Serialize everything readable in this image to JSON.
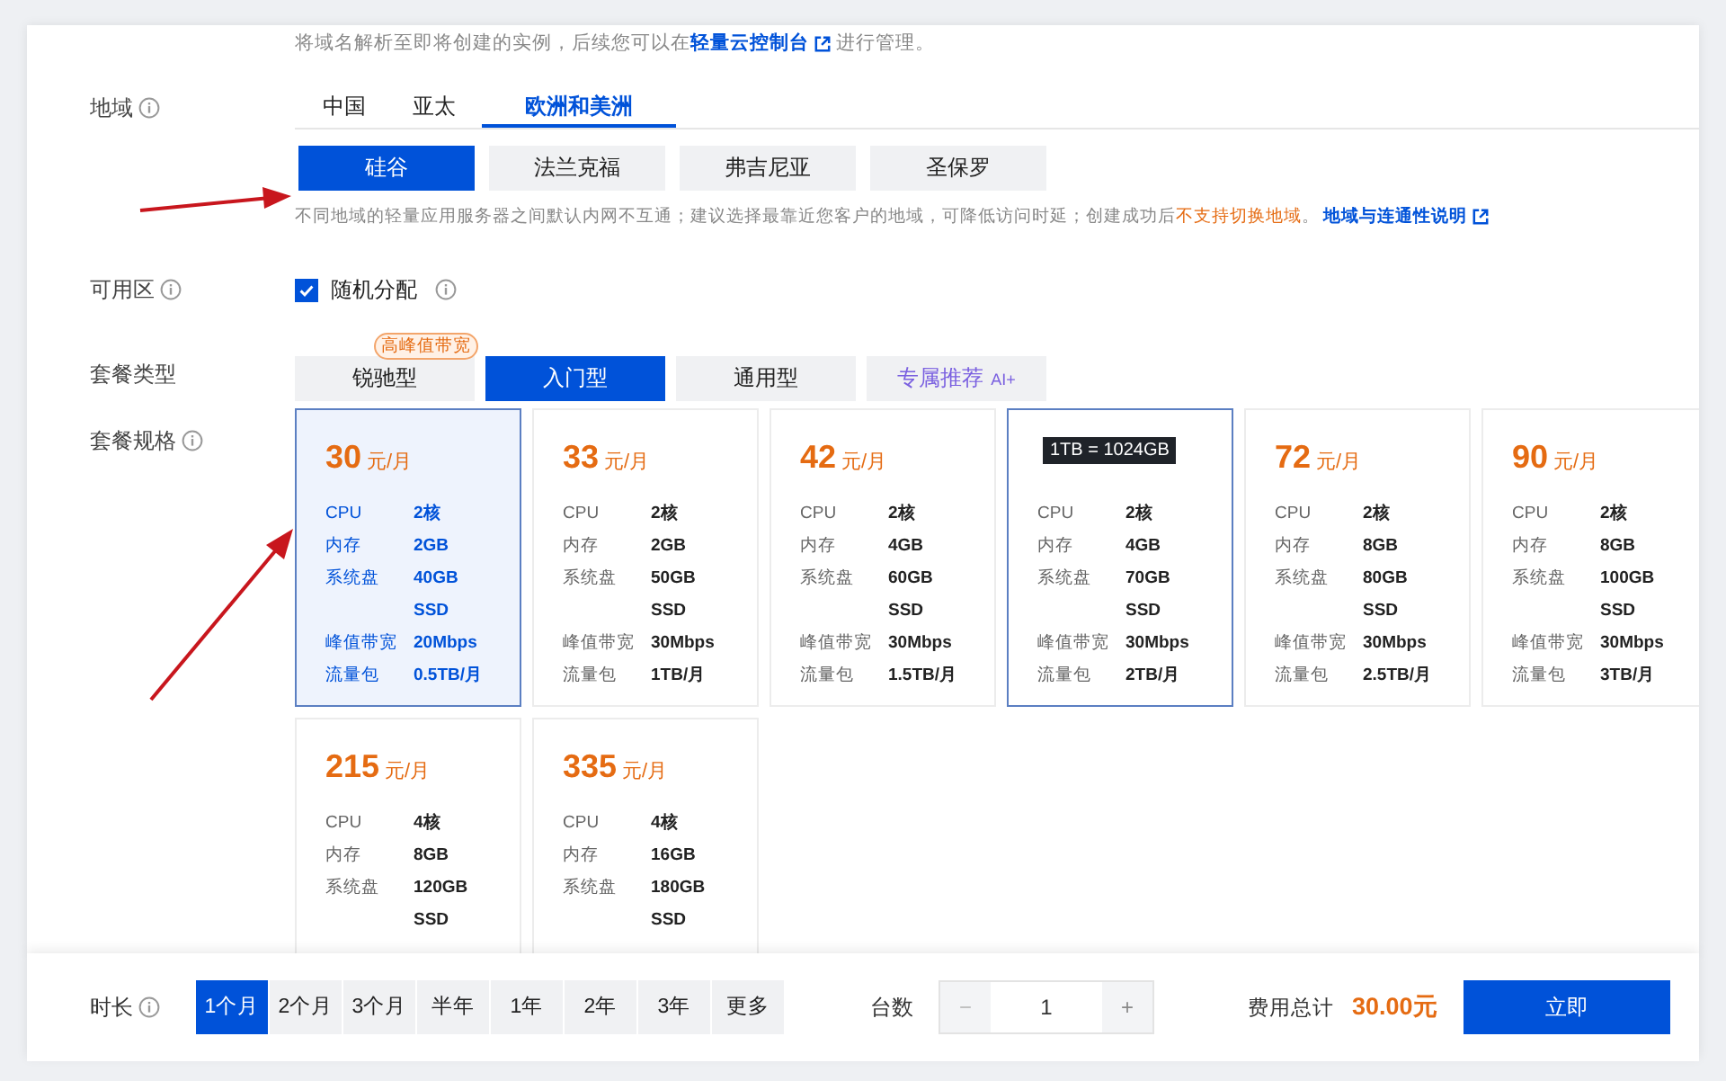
{
  "intro": {
    "before": "将域名解析至即将创建的实例，后续您可以在",
    "link": "轻量云控制台",
    "after": "进行管理。"
  },
  "region": {
    "label": "地域",
    "tabs": [
      {
        "label": "中国",
        "selected": false
      },
      {
        "label": "亚太",
        "selected": false
      },
      {
        "label": "欧洲和美洲",
        "selected": true
      }
    ],
    "cities": [
      {
        "label": "硅谷",
        "selected": true
      },
      {
        "label": "法兰克福",
        "selected": false
      },
      {
        "label": "弗吉尼亚",
        "selected": false
      },
      {
        "label": "圣保罗",
        "selected": false
      }
    ],
    "hint": {
      "text": "不同地域的轻量应用服务器之间默认内网不互通；建议选择最靠近您客户的地域，可降低访问时延；创建成功后",
      "warning": "不支持切换地域",
      "after": "。",
      "link": "地域与连通性说明"
    }
  },
  "zone": {
    "label": "可用区",
    "option": {
      "label": "随机分配",
      "checked": true
    }
  },
  "plan_type": {
    "label": "套餐类型",
    "options": [
      {
        "label": "锐驰型",
        "selected": false,
        "badge": "高峰值带宽"
      },
      {
        "label": "入门型",
        "selected": true
      },
      {
        "label": "通用型",
        "selected": false
      },
      {
        "label": "专属推荐",
        "selected": false,
        "tag": "AI+"
      }
    ]
  },
  "plan_spec": {
    "label": "套餐规格",
    "tooltip": "1TB = 1024GB",
    "cards": [
      {
        "price": "30",
        "unit": "元/月",
        "selected": true,
        "hovered": false,
        "specs": [
          {
            "name": "CPU",
            "value": "2核"
          },
          {
            "name": "内存",
            "value": "2GB"
          },
          {
            "name": "系统盘",
            "value": "40GB SSD"
          },
          {
            "name": "峰值带宽",
            "value": "20Mbps"
          },
          {
            "name": "流量包",
            "value": "0.5TB/月"
          }
        ]
      },
      {
        "price": "33",
        "unit": "元/月",
        "selected": false,
        "hovered": false,
        "specs": [
          {
            "name": "CPU",
            "value": "2核"
          },
          {
            "name": "内存",
            "value": "2GB"
          },
          {
            "name": "系统盘",
            "value": "50GB SSD"
          },
          {
            "name": "峰值带宽",
            "value": "30Mbps"
          },
          {
            "name": "流量包",
            "value": "1TB/月"
          }
        ]
      },
      {
        "price": "42",
        "unit": "元/月",
        "selected": false,
        "hovered": false,
        "specs": [
          {
            "name": "CPU",
            "value": "2核"
          },
          {
            "name": "内存",
            "value": "4GB"
          },
          {
            "name": "系统盘",
            "value": "60GB SSD"
          },
          {
            "name": "峰值带宽",
            "value": "30Mbps"
          },
          {
            "name": "流量包",
            "value": "1.5TB/月"
          }
        ]
      },
      {
        "selected": false,
        "hovered": true,
        "specs": [
          {
            "name": "CPU",
            "value": "2核"
          },
          {
            "name": "内存",
            "value": "4GB"
          },
          {
            "name": "系统盘",
            "value": "70GB SSD"
          },
          {
            "name": "峰值带宽",
            "value": "30Mbps"
          },
          {
            "name": "流量包",
            "value": "2TB/月"
          }
        ]
      },
      {
        "price": "72",
        "unit": "元/月",
        "selected": false,
        "hovered": false,
        "specs": [
          {
            "name": "CPU",
            "value": "2核"
          },
          {
            "name": "内存",
            "value": "8GB"
          },
          {
            "name": "系统盘",
            "value": "80GB SSD"
          },
          {
            "name": "峰值带宽",
            "value": "30Mbps"
          },
          {
            "name": "流量包",
            "value": "2.5TB/月"
          }
        ]
      },
      {
        "price": "90",
        "unit": "元/月",
        "selected": false,
        "hovered": false,
        "specs": [
          {
            "name": "CPU",
            "value": "2核"
          },
          {
            "name": "内存",
            "value": "8GB"
          },
          {
            "name": "系统盘",
            "value": "100GB SSD"
          },
          {
            "name": "峰值带宽",
            "value": "30Mbps"
          },
          {
            "name": "流量包",
            "value": "3TB/月"
          }
        ]
      },
      {
        "price": "215",
        "unit": "元/月",
        "selected": false,
        "hovered": false,
        "specs": [
          {
            "name": "CPU",
            "value": "4核"
          },
          {
            "name": "内存",
            "value": "8GB"
          },
          {
            "name": "系统盘",
            "value": "120GB SSD"
          }
        ]
      },
      {
        "price": "335",
        "unit": "元/月",
        "selected": false,
        "hovered": false,
        "specs": [
          {
            "name": "CPU",
            "value": "4核"
          },
          {
            "name": "内存",
            "value": "16GB"
          },
          {
            "name": "系统盘",
            "value": "180GB SSD"
          }
        ]
      }
    ]
  },
  "footer": {
    "duration": {
      "label": "时长",
      "options": [
        {
          "label": "1个月",
          "selected": true
        },
        {
          "label": "2个月",
          "selected": false
        },
        {
          "label": "3个月",
          "selected": false
        },
        {
          "label": "半年",
          "selected": false
        },
        {
          "label": "1年",
          "selected": false
        },
        {
          "label": "2年",
          "selected": false
        },
        {
          "label": "3年",
          "selected": false
        },
        {
          "label": "更多",
          "selected": false
        }
      ]
    },
    "quantity": {
      "label": "台数",
      "value": "1",
      "minus": "−",
      "plus": "+",
      "minus_disabled": true
    },
    "total": {
      "label": "费用总计",
      "amount": "30.00元"
    },
    "buy_button": "立即"
  }
}
